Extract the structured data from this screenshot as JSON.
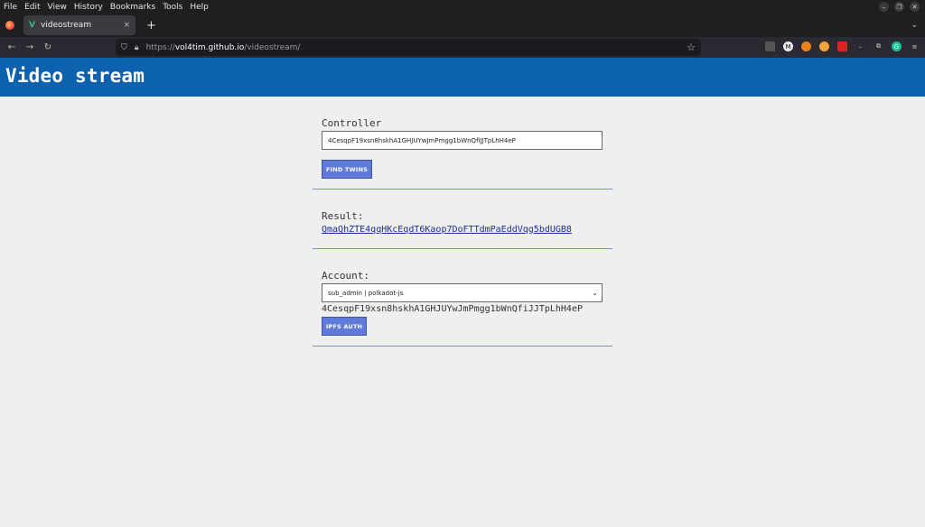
{
  "menu": [
    "File",
    "Edit",
    "View",
    "History",
    "Bookmarks",
    "Tools",
    "Help"
  ],
  "tab": {
    "title": "videostream",
    "close": "×"
  },
  "new_tab": "+",
  "url": {
    "proto": "https://",
    "host": "vol4tim.github.io",
    "path": "/videostream/"
  },
  "header": {
    "title": "Video stream"
  },
  "controller": {
    "label": "Controller",
    "value": "4CesqpF19xsn8hskhA1GHJUYwJmPmgg1bWnQfiJJTpLhH4eP",
    "button": "FIND TWINS"
  },
  "result": {
    "label": "Result:",
    "link": "QmaQhZTE4qqHKcEqdT6Kaop7DoFTTdmPaEddVqg5bdUGB8"
  },
  "account": {
    "label": "Account:",
    "selected": "sub_admin | polkadot-js",
    "address": "4CesqpF19xsn8hskhA1GHJUYwJmPmgg1bWnQfiJJTpLhH4eP",
    "button": "IPFS AUTH"
  }
}
